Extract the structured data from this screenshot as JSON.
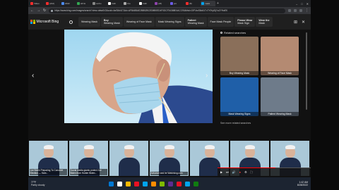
{
  "browser": {
    "tabs": [
      {
        "label": "Video",
        "color": "#ff2d2d"
      },
      {
        "label": "(212)",
        "color": "#ff2d2d"
      },
      {
        "label": "2022",
        "color": "#4c8bf5"
      },
      {
        "label": "All Gi",
        "color": "#34a853"
      },
      {
        "label": "curbo",
        "color": "#888888"
      },
      {
        "label": "truth",
        "color": "#ffffff"
      },
      {
        "label": "Cre",
        "color": "#aaaaaa"
      },
      {
        "label": "truth",
        "color": "#ffffff"
      },
      {
        "label": "(24)",
        "color": "#8e44ad"
      },
      {
        "label": "pro",
        "color": "#6c5ce7"
      },
      {
        "label": "(8)",
        "color": "#ff2d2d"
      },
      {
        "label": "mask",
        "color": "#00a4ef"
      }
    ],
    "new_tab": "+",
    "window_controls": [
      "–",
      "□",
      "✕"
    ],
    "url": "https://www.bing.com/images/search?view=detailV2&ccid=4wS8d41T&id=AF8A8BAE2BB52BCED8B0ED4F0DCF34388E4ACC90&thid=OIP.4wS8d41TxTYfXyIDjYuZYHaEK"
  },
  "bing": {
    "logo_text": "Microsoft Bing",
    "chips": [
      {
        "bold": "",
        "rest": "Wearing Mask"
      },
      {
        "bold": "Boy",
        "rest": "Wearing Mask"
      },
      {
        "bold": "",
        "rest": "Wearing of Face Mask"
      },
      {
        "bold": "",
        "rest": "Mask Wearing Signs"
      },
      {
        "bold": "Patient",
        "rest": "Wearing Mask"
      },
      {
        "bold": "",
        "rest": "Face Mask People"
      },
      {
        "bold": "Please Wear",
        "rest": "Mask Sign"
      },
      {
        "bold": "Wear the",
        "rest": "Mask"
      }
    ],
    "header_icons": [
      "⊞",
      "✕"
    ]
  },
  "viewer": {
    "prev_arrow": "‹",
    "next_arrow": "›",
    "related_title": "Related searches",
    "related": [
      {
        "label": "Boy Wearing Mask",
        "bg": "#8a6f5a"
      },
      {
        "label": "Wearing of Face Mask",
        "bg": "#b48a72"
      },
      {
        "label": "Mask Wearing Signs",
        "bg": "#1f5fa8"
      },
      {
        "label": "Patient Wearing Mask",
        "bg": "#6e7b8a"
      }
    ],
    "more_related": "See more related searches"
  },
  "thumbnails": [
    {
      "caption": "Joe Biden Preparing To Concede Election — Sam..."
    },
    {
      "caption": "Social media giants protect Joe Biden from Hunter Biden..."
    },
    {
      "caption": ""
    },
    {
      "caption": "Advance and be Watchdog.com"
    },
    {
      "caption": ""
    },
    {
      "caption": ""
    },
    {
      "caption": ""
    }
  ],
  "video_controls": {
    "buttons": [
      "▶",
      "⏭",
      "🔊",
      "●",
      "⚙",
      "⛶"
    ],
    "progress_fraction": 0.62
  },
  "taskbar": {
    "temp": "77°F",
    "weather": "Partly cloudy",
    "icons": [
      "#0078d4",
      "#ffffff",
      "#ffb900",
      "#e81123",
      "#00a4ef",
      "#ff8c00",
      "#7fba00",
      "#5c2d91",
      "#e81123",
      "#00a4ef",
      "#107c10"
    ],
    "time": "1:42 AM",
    "date": "8/28/2022"
  }
}
